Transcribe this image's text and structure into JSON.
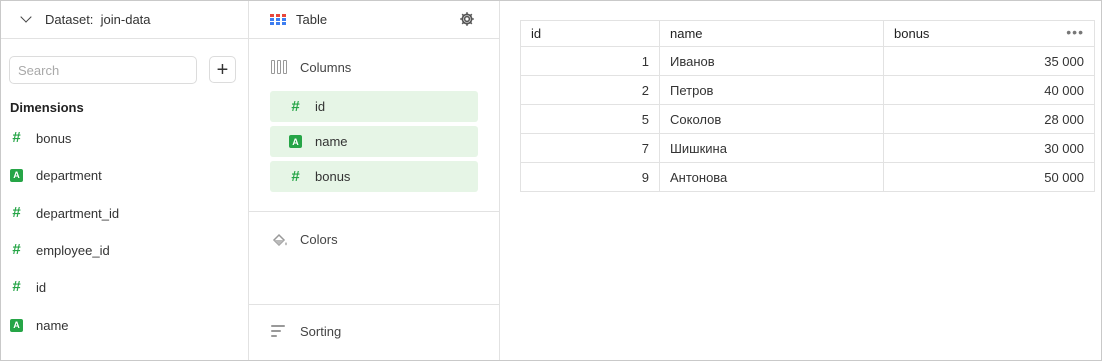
{
  "dataset": {
    "label": "Dataset:",
    "name": "join-data"
  },
  "search": {
    "placeholder": "Search",
    "value": ""
  },
  "add_label": "+",
  "dimensions": {
    "title": "Dimensions",
    "items": [
      {
        "label": "bonus",
        "type": "number"
      },
      {
        "label": "department",
        "type": "string"
      },
      {
        "label": "department_id",
        "type": "number"
      },
      {
        "label": "employee_id",
        "type": "number"
      },
      {
        "label": "id",
        "type": "number"
      },
      {
        "label": "name",
        "type": "string"
      }
    ]
  },
  "visualization": {
    "label": "Table"
  },
  "sections": {
    "columns": "Columns",
    "colors": "Colors",
    "sorting": "Sorting"
  },
  "column_chips": [
    {
      "label": "id",
      "type": "number"
    },
    {
      "label": "name",
      "type": "string"
    },
    {
      "label": "bonus",
      "type": "number"
    }
  ],
  "icon_glyphs": {
    "number": "#",
    "string": "A"
  },
  "table": {
    "headers": [
      "id",
      "name",
      "bonus"
    ],
    "menu": "•••",
    "rows": [
      [
        "1",
        "Иванов",
        "35 000"
      ],
      [
        "2",
        "Петров",
        "40 000"
      ],
      [
        "5",
        "Соколов",
        "28 000"
      ],
      [
        "7",
        "Шишкина",
        "30 000"
      ],
      [
        "9",
        "Антонова",
        "50 000"
      ]
    ]
  },
  "colors": {
    "accent_green": "#26a547",
    "chip_bg": "#e6f5e6",
    "table_icon_blue": "#3e7ef0",
    "table_icon_red": "#e8463a"
  }
}
